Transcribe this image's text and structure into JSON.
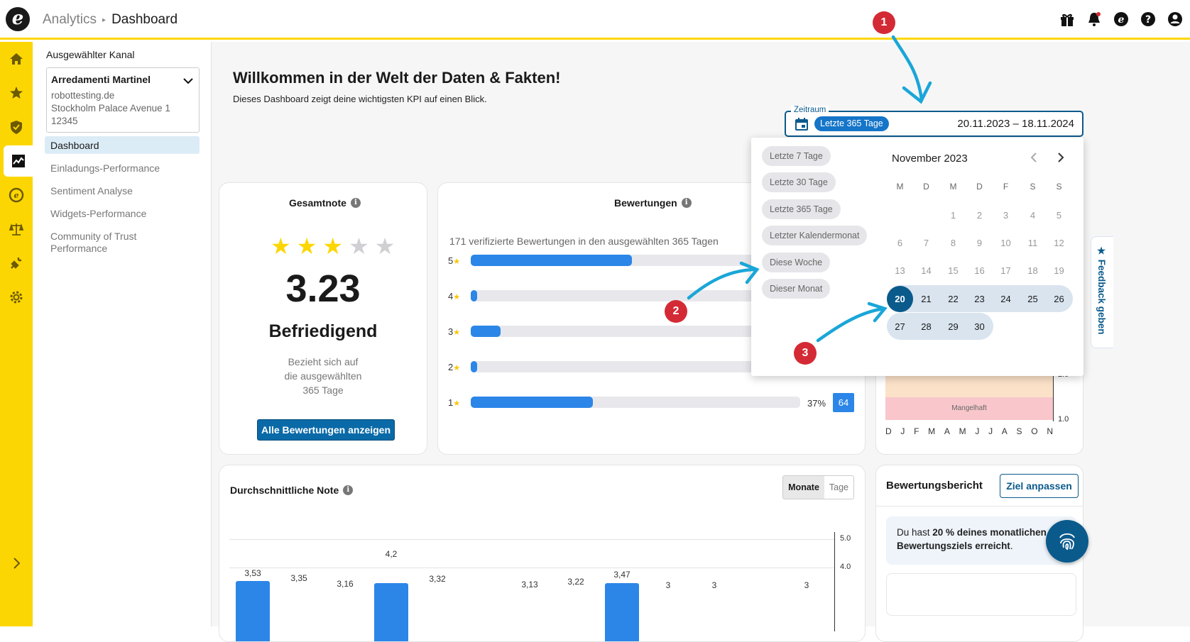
{
  "header": {
    "breadcrumb_parent": "Analytics",
    "breadcrumb_current": "Dashboard",
    "logo_letter": "e"
  },
  "channel": {
    "label": "Ausgewählter Kanal",
    "name": "Arredamenti Martinel",
    "domain": "robottesting.de",
    "address1": "Stockholm Palace Avenue 1",
    "address2": "12345"
  },
  "nav": [
    "Dashboard",
    "Einladungs-Performance",
    "Sentiment Analyse",
    "Widgets-Performance",
    "Community of Trust",
    "Performance"
  ],
  "welcome": {
    "title": "Willkommen in der Welt der Daten & Fakten!",
    "subtitle": "Dieses Dashboard zeigt deine wichtigsten KPI auf einen Blick."
  },
  "zeitraum": {
    "label": "Zeitraum",
    "chip": "Letzte 365 Tage",
    "range": "20.11.2023 – 18.11.2024"
  },
  "datepicker": {
    "quick": [
      "Letzte 7 Tage",
      "Letzte 30 Tage",
      "Letzte 365 Tage",
      "Letzter Kalendermonat",
      "Diese Woche",
      "Dieser Monat"
    ],
    "month": "November 2023",
    "weekdays": [
      "M",
      "D",
      "M",
      "D",
      "F",
      "S",
      "S"
    ],
    "rows": [
      [
        "",
        "",
        "1",
        "2",
        "3",
        "4",
        "5"
      ],
      [
        "6",
        "7",
        "8",
        "9",
        "10",
        "11",
        "12"
      ],
      [
        "13",
        "14",
        "15",
        "16",
        "17",
        "18",
        "19"
      ],
      [
        "20",
        "21",
        "22",
        "23",
        "24",
        "25",
        "26"
      ],
      [
        "27",
        "28",
        "29",
        "30",
        "",
        "",
        ""
      ]
    ]
  },
  "gesamtnote": {
    "title": "Gesamtnote",
    "info": "i",
    "stars_filled": 3,
    "stars_total": 5,
    "star_glyph": "★",
    "score": "3.23",
    "rating": "Befriedigend",
    "refers1": "Bezieht sich auf",
    "refers2": "die ausgewählten",
    "refers3": "365 Tage",
    "button": "Alle Bewertungen anzeigen"
  },
  "bewertungen": {
    "title": "Bewertungen",
    "info": "i",
    "summary": "171 verifizierte Bewertungen in den ausgewählten 365 Tagen",
    "rows": [
      {
        "label": "5",
        "fraction": 0.49
      },
      {
        "label": "4",
        "fraction": 0.02
      },
      {
        "label": "3",
        "fraction": 0.09
      },
      {
        "label": "2",
        "fraction": 0.02
      },
      {
        "label": "1",
        "fraction": 0.37,
        "pct": "37%",
        "count": "64"
      }
    ]
  },
  "minichart": {
    "band": "Mangelhaft",
    "y_label": "1.0",
    "y_top": "2.0",
    "months": [
      "D",
      "J",
      "F",
      "M",
      "A",
      "M",
      "J",
      "J",
      "A",
      "S",
      "O",
      "N"
    ]
  },
  "durchschnitt": {
    "title": "Durchschnittliche Note",
    "info": "i",
    "toggle_on": "Monate",
    "toggle_off": "Tage",
    "y_ticks": [
      "5.0",
      "4.0"
    ]
  },
  "chart_data": {
    "type": "bar",
    "title": "Durchschnittliche Note",
    "ylim": [
      0,
      5
    ],
    "values_labels": [
      "3,53",
      "3,35",
      "3,16",
      "4,2",
      "3,32",
      "",
      "3,13",
      "3,22",
      "3,47",
      "3",
      "3",
      "",
      "3"
    ],
    "values": [
      3.53,
      3.35,
      3.16,
      4.2,
      3.32,
      null,
      3.13,
      3.22,
      3.47,
      3,
      3,
      null,
      3
    ]
  },
  "bericht": {
    "title": "Bewertungsbericht",
    "button": "Ziel anpassen",
    "msg_pre": "Du hast ",
    "msg_bold": "20 % deines monatlichen Bewertungsziels erreicht",
    "msg_post": "."
  },
  "feedback": {
    "label": "Feedback geben",
    "star": "★"
  },
  "markers": [
    "1",
    "2",
    "3"
  ],
  "colors": {
    "accent_yellow": "#fcd603",
    "primary_blue": "#0a5a8c",
    "bar_blue": "#2b86e8",
    "marker_red": "#d42a35",
    "arrow_cyan": "#1aa6d8"
  }
}
